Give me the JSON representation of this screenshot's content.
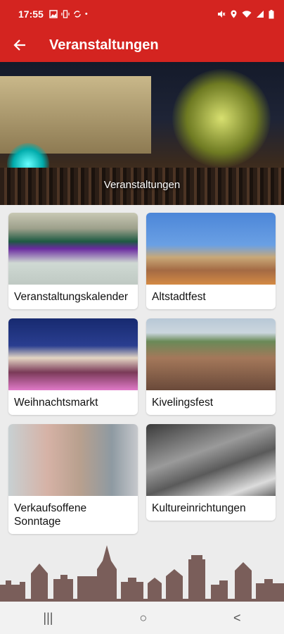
{
  "status": {
    "time": "17:55",
    "left_icons": [
      "image-icon",
      "vibrate-icon",
      "sync-icon",
      "dot"
    ],
    "right_icons": [
      "mute-icon",
      "location-icon",
      "wifi-icon",
      "signal-icon",
      "battery-icon"
    ]
  },
  "appbar": {
    "title": "Veranstaltungen",
    "color": "#d42420"
  },
  "hero": {
    "caption": "Veranstaltungen"
  },
  "cards": [
    {
      "label": "Veranstaltungskalender"
    },
    {
      "label": "Altstadtfest"
    },
    {
      "label": "Weihnachtsmarkt"
    },
    {
      "label": "Kivelingsfest"
    },
    {
      "label": "Verkaufsoffene Sonntage"
    },
    {
      "label": "Kultureinrichtungen"
    }
  ],
  "navbar": {
    "recents": "|||",
    "home": "○",
    "back": "<"
  }
}
